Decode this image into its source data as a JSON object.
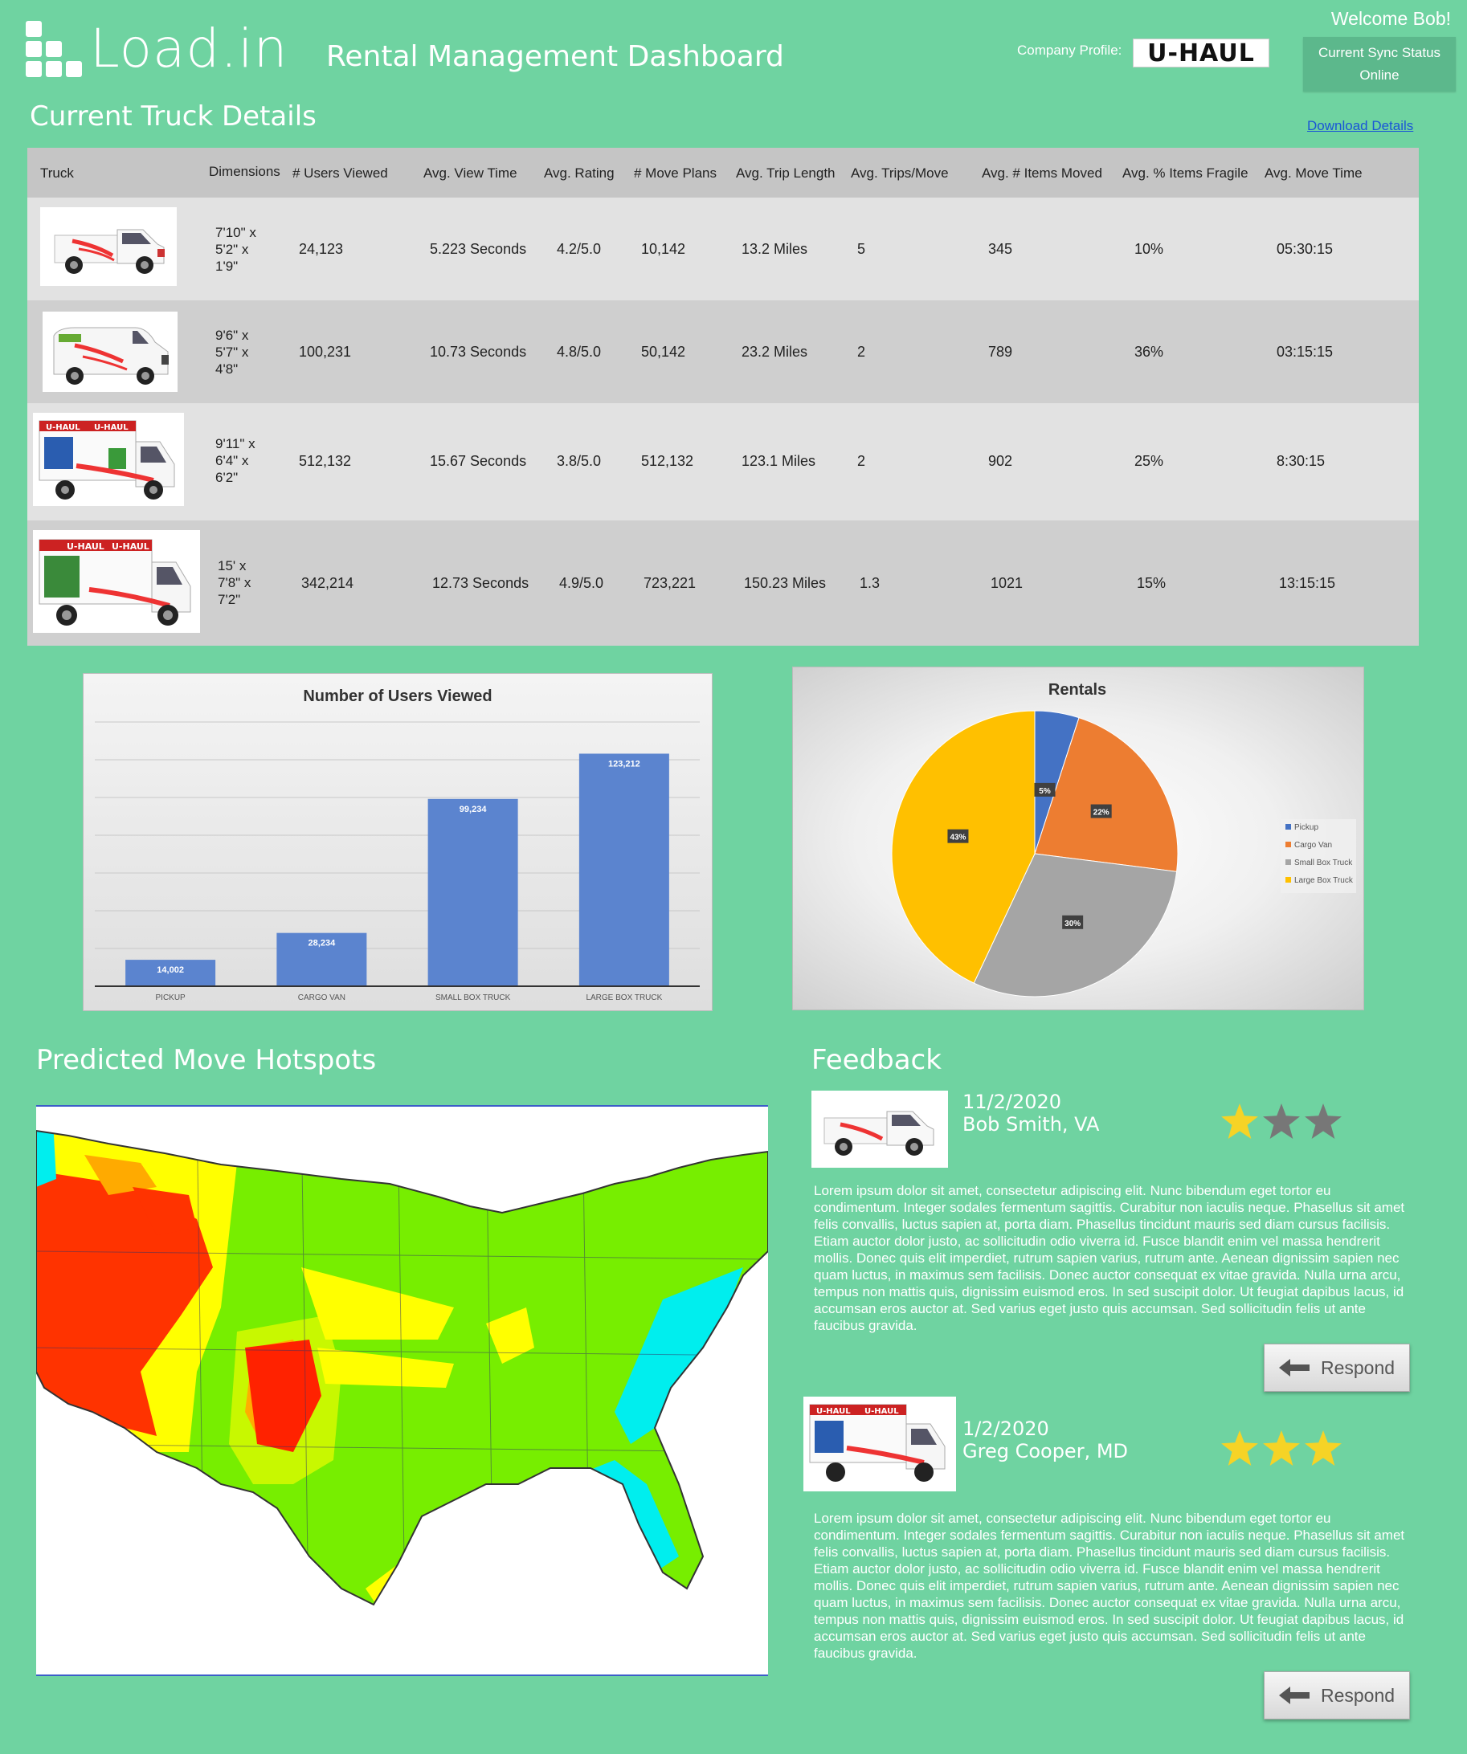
{
  "header": {
    "app_name": "Load.in",
    "page_title": "Rental Management Dashboard",
    "welcome": "Welcome Bob!",
    "company_profile_label": "Company Profile:",
    "company_logo_text": "U-HAUL",
    "sync_status_label": "Current Sync Status",
    "sync_status_value": "Online"
  },
  "truck_details": {
    "title": "Current Truck Details",
    "download_link": "Download Details",
    "columns": [
      "Truck",
      "Dimensions",
      "# Users Viewed",
      "Avg. View Time",
      "Avg. Rating",
      "# Move Plans",
      "Avg. Trip Length",
      "Avg. Trips/Move",
      "Avg. # Items Moved",
      "Avg. % Items Fragile",
      "Avg. Move Time"
    ],
    "rows": [
      {
        "truck_icon": "pickup-truck-image",
        "dim1": "7'10\" x",
        "dim2": "5'2\" x",
        "dim3": "1'9\"",
        "users_viewed": "24,123",
        "view_time": "5.223 Seconds",
        "rating": "4.2/5.0",
        "move_plans": "10,142",
        "trip_length": "13.2 Miles",
        "trips_move": "5",
        "items_moved": "345",
        "pct_fragile": "10%",
        "move_time": "05:30:15"
      },
      {
        "truck_icon": "cargo-van-image",
        "dim1": "9'6\" x",
        "dim2": "5'7\" x",
        "dim3": "4'8\"",
        "users_viewed": "100,231",
        "view_time": "10.73 Seconds",
        "rating": "4.8/5.0",
        "move_plans": "50,142",
        "trip_length": "23.2 Miles",
        "trips_move": "2",
        "items_moved": "789",
        "pct_fragile": "36%",
        "move_time": "03:15:15"
      },
      {
        "truck_icon": "small-box-truck-image",
        "dim1": "9'11\" x",
        "dim2": "6'4\" x",
        "dim3": "6'2\"",
        "users_viewed": "512,132",
        "view_time": "15.67 Seconds",
        "rating": "3.8/5.0",
        "move_plans": "512,132",
        "trip_length": "123.1 Miles",
        "trips_move": "2",
        "items_moved": "902",
        "pct_fragile": "25%",
        "move_time": "8:30:15"
      },
      {
        "truck_icon": "large-box-truck-image",
        "dim1": "15' x",
        "dim2": "7'8\" x",
        "dim3": "7'2\"",
        "users_viewed": "342,214",
        "view_time": "12.73 Seconds",
        "rating": "4.9/5.0",
        "move_plans": "723,221",
        "trip_length": "150.23 Miles",
        "trips_move": "1.3",
        "items_moved": "1021",
        "pct_fragile": "15%",
        "move_time": "13:15:15"
      }
    ]
  },
  "chart_data": [
    {
      "type": "bar",
      "title": "Number of Users Viewed",
      "categories": [
        "PICKUP",
        "CARGO VAN",
        "SMALL BOX TRUCK",
        "LARGE BOX TRUCK"
      ],
      "values": [
        14002,
        28234,
        99234,
        123212
      ],
      "value_labels": [
        "14,002",
        "28,234",
        "99,234",
        "123,212"
      ],
      "ylim": [
        0,
        140000
      ],
      "grid": true,
      "color": "#5b84cf"
    },
    {
      "type": "pie",
      "title": "Rentals",
      "labels": [
        "Pickup",
        "Cargo Van",
        "Small Box Truck",
        "Large Box Truck"
      ],
      "values": [
        5,
        22,
        30,
        43
      ],
      "value_labels": [
        "5%",
        "22%",
        "30%",
        "43%"
      ],
      "colors": [
        "#4472c4",
        "#ed7d31",
        "#a5a5a5",
        "#ffc000"
      ],
      "legend": "right"
    }
  ],
  "hotspots": {
    "title": "Predicted Move Hotspots",
    "map_icon": "us-heat-map-image"
  },
  "feedback": {
    "title": "Feedback",
    "items": [
      {
        "date": "11/2/2020",
        "name": "Bob Smith, VA",
        "rating": 1,
        "truck_icon": "pickup-truck-image",
        "text": "Lorem ipsum dolor sit amet, consectetur adipiscing elit. Nunc bibendum eget tortor eu condimentum. Integer sodales fermentum sagittis. Curabitur non iaculis neque. Phasellus sit amet felis convallis, luctus sapien at, porta diam. Phasellus tincidunt mauris sed diam cursus facilisis. Etiam auctor dolor justo, ac sollicitudin odio viverra id. Fusce blandit enim vel massa hendrerit mollis. Donec quis elit imperdiet, rutrum sapien varius, rutrum ante. Aenean dignissim sapien nec quam luctus, in maximus sem facilisis. Donec auctor consequat ex vitae gravida. Nulla urna arcu, tempus non mattis quis, dignissim euismod eros. In sed suscipit dolor. Ut feugiat dapibus lacus, id accumsan eros auctor at. Sed varius eget justo quis accumsan. Sed sollicitudin felis ut ante faucibus gravida.",
        "respond": "Respond"
      },
      {
        "date": "1/2/2020",
        "name": "Greg Cooper, MD",
        "rating": 3,
        "truck_icon": "small-box-truck-image",
        "text": "Lorem ipsum dolor sit amet, consectetur adipiscing elit. Nunc bibendum eget tortor eu condimentum. Integer sodales fermentum sagittis. Curabitur non iaculis neque. Phasellus sit amet felis convallis, luctus sapien at, porta diam. Phasellus tincidunt mauris sed diam cursus facilisis. Etiam auctor dolor justo, ac sollicitudin odio viverra id. Fusce blandit enim vel massa hendrerit mollis. Donec quis elit imperdiet, rutrum sapien varius, rutrum ante. Aenean dignissim sapien nec quam luctus, in maximus sem facilisis. Donec auctor consequat ex vitae gravida. Nulla urna arcu, tempus non mattis quis, dignissim euismod eros. In sed suscipit dolor. Ut feugiat dapibus lacus, id accumsan eros auctor at. Sed varius eget justo quis accumsan. Sed sollicitudin felis ut ante faucibus gravida.",
        "respond": "Respond"
      }
    ]
  },
  "colors": {
    "background": "#6fd3a1",
    "star_filled": "#f6d326",
    "star_empty": "#777777"
  }
}
